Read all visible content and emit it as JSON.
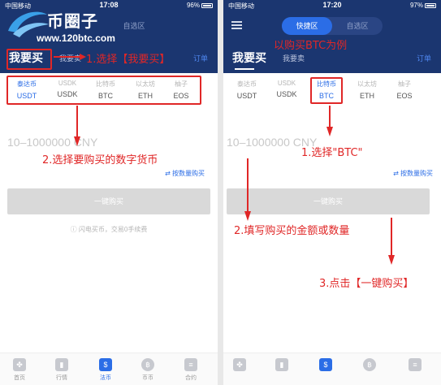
{
  "colors": {
    "header": "#1b3670",
    "accent": "#2b6de6",
    "annotation": "#e02727"
  },
  "watermark": {
    "brand": "币圈子",
    "url": "www.120btc.com"
  },
  "left": {
    "status": {
      "carrier": "中国移动",
      "time": "17:08",
      "right": "96%"
    },
    "segment": {
      "off": "自选区"
    },
    "tabs": {
      "buy": "我要买",
      "sell": "我要卖",
      "orders": "订单"
    },
    "coins": [
      {
        "cn": "泰达币",
        "code": "USDT",
        "active": true
      },
      {
        "cn": "USDK",
        "code": "USDK",
        "active": false
      },
      {
        "cn": "比特币",
        "code": "BTC",
        "active": false
      },
      {
        "cn": "以太坊",
        "code": "ETH",
        "active": false
      },
      {
        "cn": "柚子",
        "code": "EOS",
        "active": false
      }
    ],
    "amount_placeholder": "10–1000000 CNY",
    "by_quantity": "按数量购买",
    "buy_button": "一键购买",
    "fee_note": "闪电买币，交易0手续费",
    "nav": [
      "首页",
      "行情",
      "法币",
      "币币",
      "合约"
    ],
    "annotations": {
      "step1": "1.选择【我要买】",
      "step2": "2.选择要购买的数字货币"
    }
  },
  "right": {
    "status": {
      "carrier": "中国移动",
      "time": "17:20",
      "right": "97%"
    },
    "segment": {
      "on": "快捷区",
      "off": "自选区"
    },
    "tabs": {
      "buy": "我要买",
      "sell": "我要卖",
      "orders": "订单"
    },
    "coins": [
      {
        "cn": "泰达币",
        "code": "USDT",
        "active": false
      },
      {
        "cn": "USDK",
        "code": "USDK",
        "active": false
      },
      {
        "cn": "比特币",
        "code": "BTC",
        "active": true
      },
      {
        "cn": "以太坊",
        "code": "ETH",
        "active": false
      },
      {
        "cn": "柚子",
        "code": "EOS",
        "active": false
      }
    ],
    "amount_placeholder": "10–1000000 CNY",
    "by_quantity": "按数量购买",
    "buy_button": "一键购买",
    "annotations": {
      "header": "以购买BTC为例",
      "step1": "1.选择\"BTC\"",
      "step2": "2.填写购买的金额或数量",
      "step3": "3.点击【一键购买】"
    }
  }
}
